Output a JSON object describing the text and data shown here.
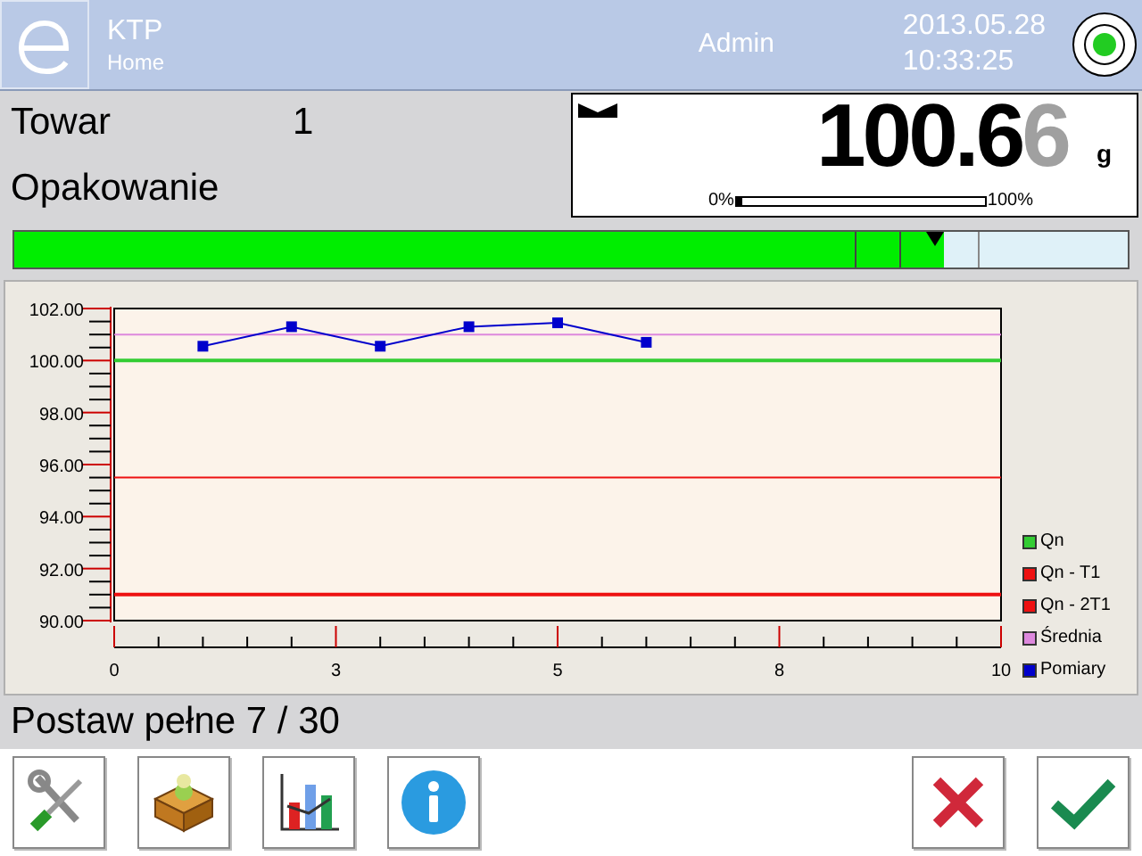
{
  "header": {
    "app": "KTP",
    "screen": "Home",
    "user": "Admin",
    "date": "2013.05.28",
    "time": "10:33:25"
  },
  "info": [
    {
      "label": "Towar",
      "value": "1"
    },
    {
      "label": "Opakowanie"
    }
  ],
  "weight": {
    "value": "100.6",
    "dim_digit": "6",
    "unit": "g",
    "range_min": "0%",
    "range_max": "100%",
    "level": 0.01
  },
  "limit_bar": {
    "level": 0.835
  },
  "chart": {
    "chart_data": {
      "type": "line",
      "x": [
        0,
        1,
        2,
        3,
        4,
        5,
        6,
        7,
        8,
        9,
        10
      ],
      "xlim": [
        0,
        10
      ],
      "ylim": [
        90,
        102
      ],
      "xticks": [
        0,
        {
          "value": 2.5,
          "label": "3"
        },
        5,
        {
          "value": 7.5,
          "label": "8"
        },
        10
      ],
      "yticks": [
        {
          "value": 90,
          "label": "90.00"
        },
        {
          "value": 92,
          "label": "92.00"
        },
        {
          "value": 94,
          "label": "94.00"
        },
        {
          "value": 96,
          "label": "96.00"
        },
        {
          "value": 98,
          "label": "98.00"
        },
        {
          "value": 100,
          "label": "100.00"
        },
        {
          "value": 102,
          "label": "102.00"
        }
      ],
      "series": [
        {
          "name": "Qn",
          "color": "#33cc33",
          "values": [
            100,
            100,
            100,
            100,
            100,
            100,
            100,
            100,
            100,
            100,
            100
          ]
        },
        {
          "name": "Qn - T1",
          "color": "#ee1111",
          "values": [
            95.5,
            95.5,
            95.5,
            95.5,
            95.5,
            95.5,
            95.5,
            95.5,
            95.5,
            95.5,
            95.5
          ]
        },
        {
          "name": "Qn - 2T1",
          "color": "#ee1111",
          "values": [
            91,
            91,
            91,
            91,
            91,
            91,
            91,
            91,
            91,
            91,
            91
          ]
        },
        {
          "name": "Średnia",
          "color": "#dd88dd",
          "values": [
            101,
            101,
            101,
            101,
            101,
            101,
            101,
            101,
            101,
            101,
            101
          ]
        },
        {
          "name": "Pomiary",
          "color": "#0000cc",
          "marker": "square",
          "values": [
            null,
            100.55,
            101.3,
            100.55,
            101.3,
            101.45,
            100.7,
            null,
            null,
            null,
            null
          ]
        }
      ]
    }
  },
  "status": "Postaw pełne 7 / 30"
}
